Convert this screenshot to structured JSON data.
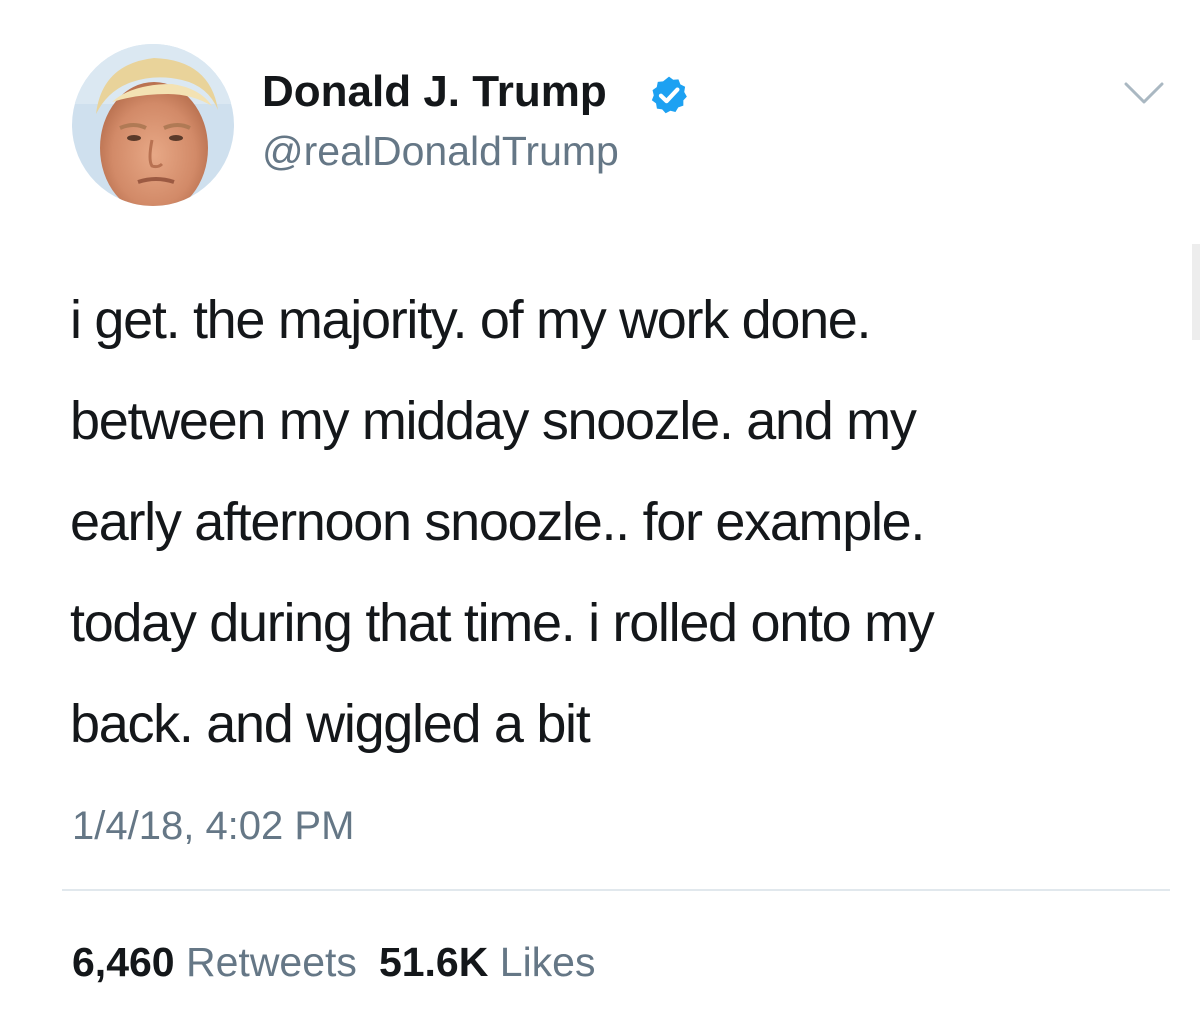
{
  "user": {
    "display_name": "Donald J. Trump",
    "handle": "@realDonaldTrump",
    "verified": true
  },
  "icons": {
    "verified": "verified-badge-icon",
    "menu": "chevron-down-icon"
  },
  "tweet": {
    "lines": [
      "i get. the majority. of my work done.",
      "between my midday snoozle. and my",
      "early afternoon snoozle.. for example.",
      "today during that time. i rolled onto my",
      "back. and wiggled a bit"
    ],
    "timestamp": "1/4/18, 4:02 PM"
  },
  "stats": {
    "retweets_count": "6,460",
    "retweets_label": "Retweets",
    "likes_count": "51.6K",
    "likes_label": "Likes"
  },
  "colors": {
    "text": "#14171a",
    "secondary": "#657786",
    "verified_blue": "#1da1f2",
    "divider": "#e1e8ed"
  }
}
